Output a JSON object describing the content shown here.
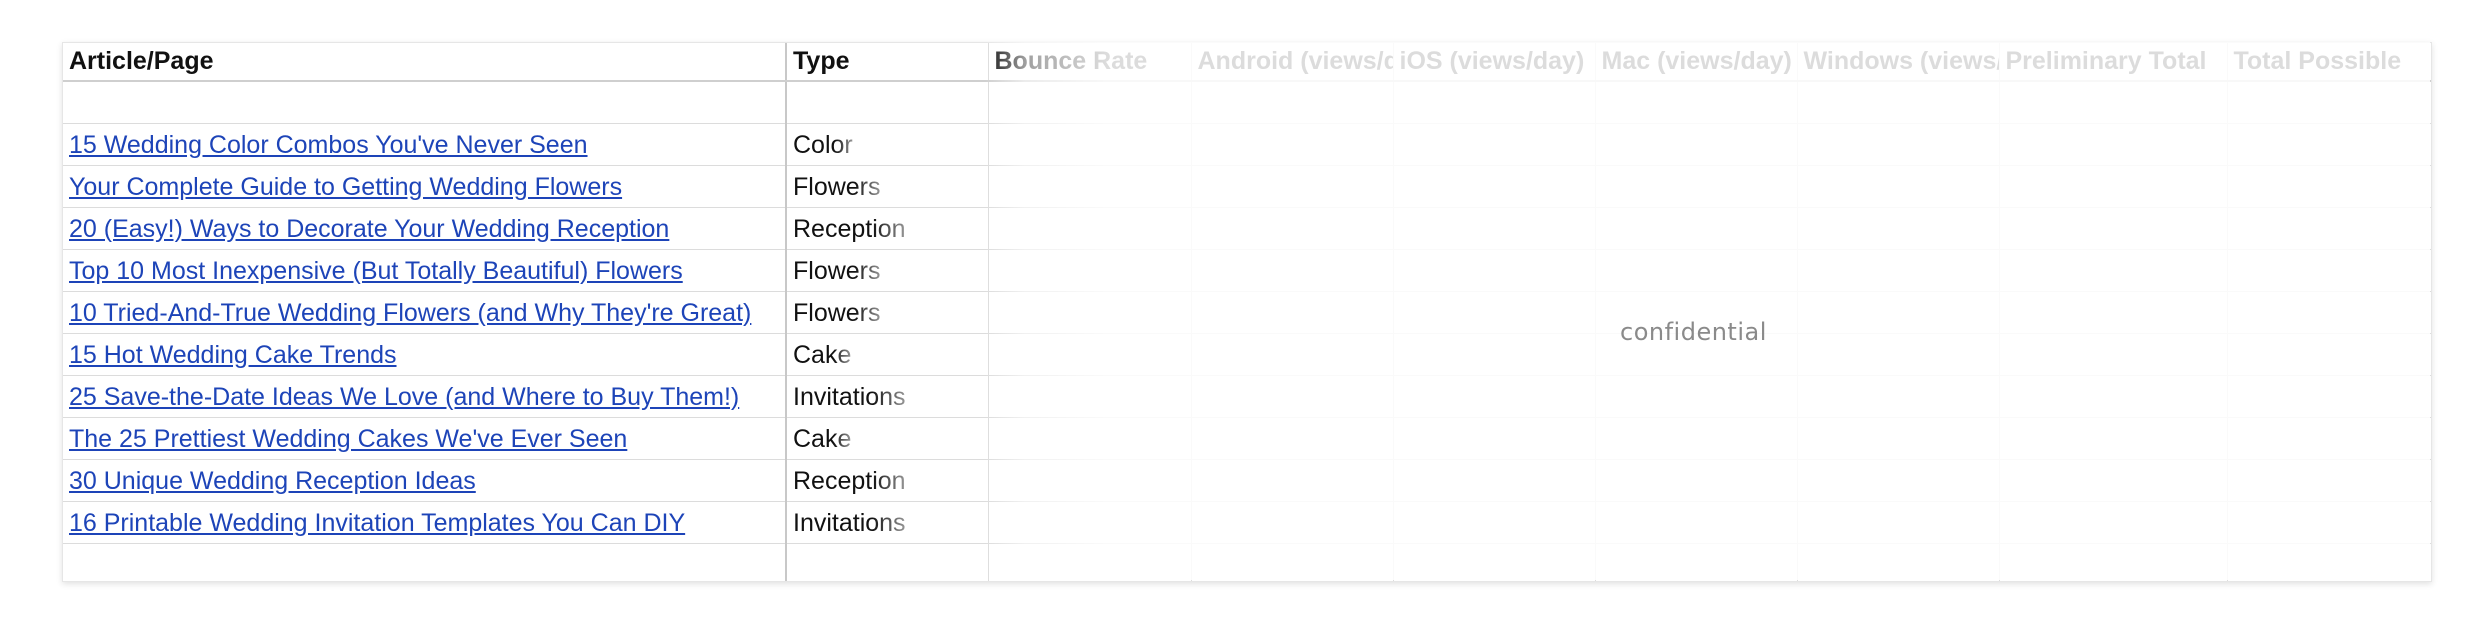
{
  "table": {
    "headers": [
      "Article/Page",
      "Type",
      "Bounce Rate",
      "Android (views/d",
      "iOS (views/day)",
      "Mac (views/day)",
      "Windows (views/",
      "Preliminary Total",
      "Total Possible"
    ],
    "rows": [
      {
        "article": "15 Wedding Color Combos You've Never Seen",
        "type": "Color",
        "values": [
          "",
          "",
          "",
          "",
          "",
          "",
          ""
        ]
      },
      {
        "article": "Your Complete Guide to Getting Wedding Flowers",
        "type": "Flowers",
        "values": [
          "",
          "",
          "",
          "",
          "",
          "",
          ""
        ]
      },
      {
        "article": "20 (Easy!) Ways to Decorate Your Wedding Reception",
        "type": "Reception",
        "values": [
          "",
          "",
          "",
          "",
          "",
          "",
          ""
        ]
      },
      {
        "article": "Top 10 Most Inexpensive (But Totally Beautiful) Flowers",
        "type": "Flowers",
        "values": [
          "",
          "",
          "",
          "",
          "",
          "",
          ""
        ]
      },
      {
        "article": "10 Tried-And-True Wedding Flowers (and Why They're Great)",
        "type": "Flowers",
        "values": [
          "",
          "",
          "",
          "",
          "",
          "",
          ""
        ]
      },
      {
        "article": "15 Hot Wedding Cake Trends",
        "type": "Cake",
        "values": [
          "",
          "",
          "",
          "",
          "",
          "",
          ""
        ]
      },
      {
        "article": "25 Save-the-Date Ideas We Love (and Where to Buy Them!)",
        "type": "Invitations",
        "values": [
          "",
          "",
          "",
          "",
          "",
          "",
          ""
        ]
      },
      {
        "article": "The 25 Prettiest Wedding Cakes We've Ever Seen",
        "type": "Cake",
        "values": [
          "",
          "",
          "",
          "",
          "",
          "",
          ""
        ]
      },
      {
        "article": "30 Unique Wedding Reception Ideas",
        "type": "Reception",
        "values": [
          "",
          "",
          "",
          "",
          "",
          "",
          ""
        ]
      },
      {
        "article": "16 Printable Wedding Invitation Templates You Can DIY",
        "type": "Invitations",
        "values": [
          "",
          "",
          "",
          "",
          "",
          "",
          ""
        ]
      }
    ]
  },
  "watermark": "confidential",
  "colors": {
    "link": "#1d44b8",
    "grid": "#dcdcdc",
    "header_text": "#111111"
  }
}
